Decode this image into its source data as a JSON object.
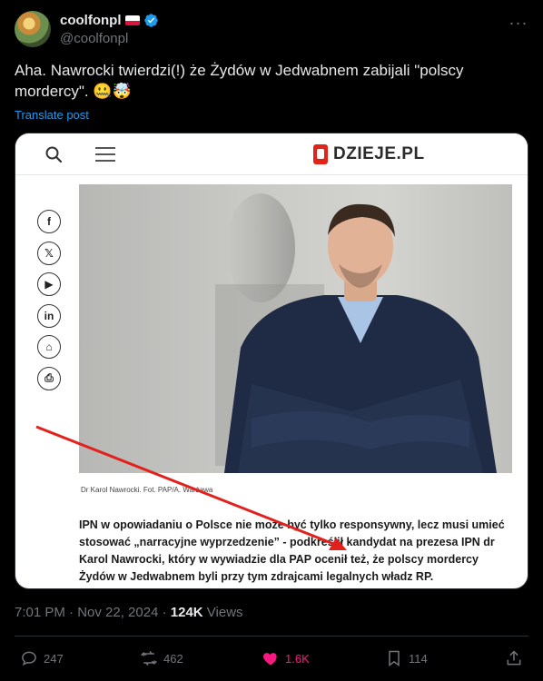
{
  "author": {
    "display_name": "coolfonpl",
    "handle": "@coolfonpl",
    "flag_icon": "poland-flag-icon",
    "verified_icon": "verified-badge-icon"
  },
  "tweet": {
    "text": "Aha. Nawrocki twierdzi(!) że Żydów w Jedwabnem zabijali \"polscy mordercy\". 🤐🤯",
    "translate_label": "Translate post"
  },
  "card": {
    "site_logo": "DZIEJE.PL",
    "share_buttons": [
      "f",
      "𝕏",
      "▶",
      "in",
      "⌂",
      "⎙"
    ],
    "caption": "Dr Karol Nawrocki. Fot. PAP/A. Warżawa",
    "article_text": "IPN w opowiadaniu o Polsce nie może być tylko responsywny, lecz musi umieć stosować „narracyjne wyprzedzenie” - podkreślił kandydat na prezesa IPN dr Karol Nawrocki, który w wywiadzie dla PAP ocenił też, że polscy mordercy Żydów w Jedwabnem byli przy tym zdrajcami legalnych władz RP."
  },
  "meta": {
    "time": "7:01 PM · Nov 22, 2024 · ",
    "views_count": "124K",
    "views_label": " Views"
  },
  "actions": {
    "replies": "247",
    "reposts": "462",
    "likes": "1.6K",
    "bookmarks": "114"
  },
  "colors": {
    "background": "#000000",
    "link": "#1d9bf0",
    "like": "#f91880",
    "arrow": "#e3201b"
  }
}
